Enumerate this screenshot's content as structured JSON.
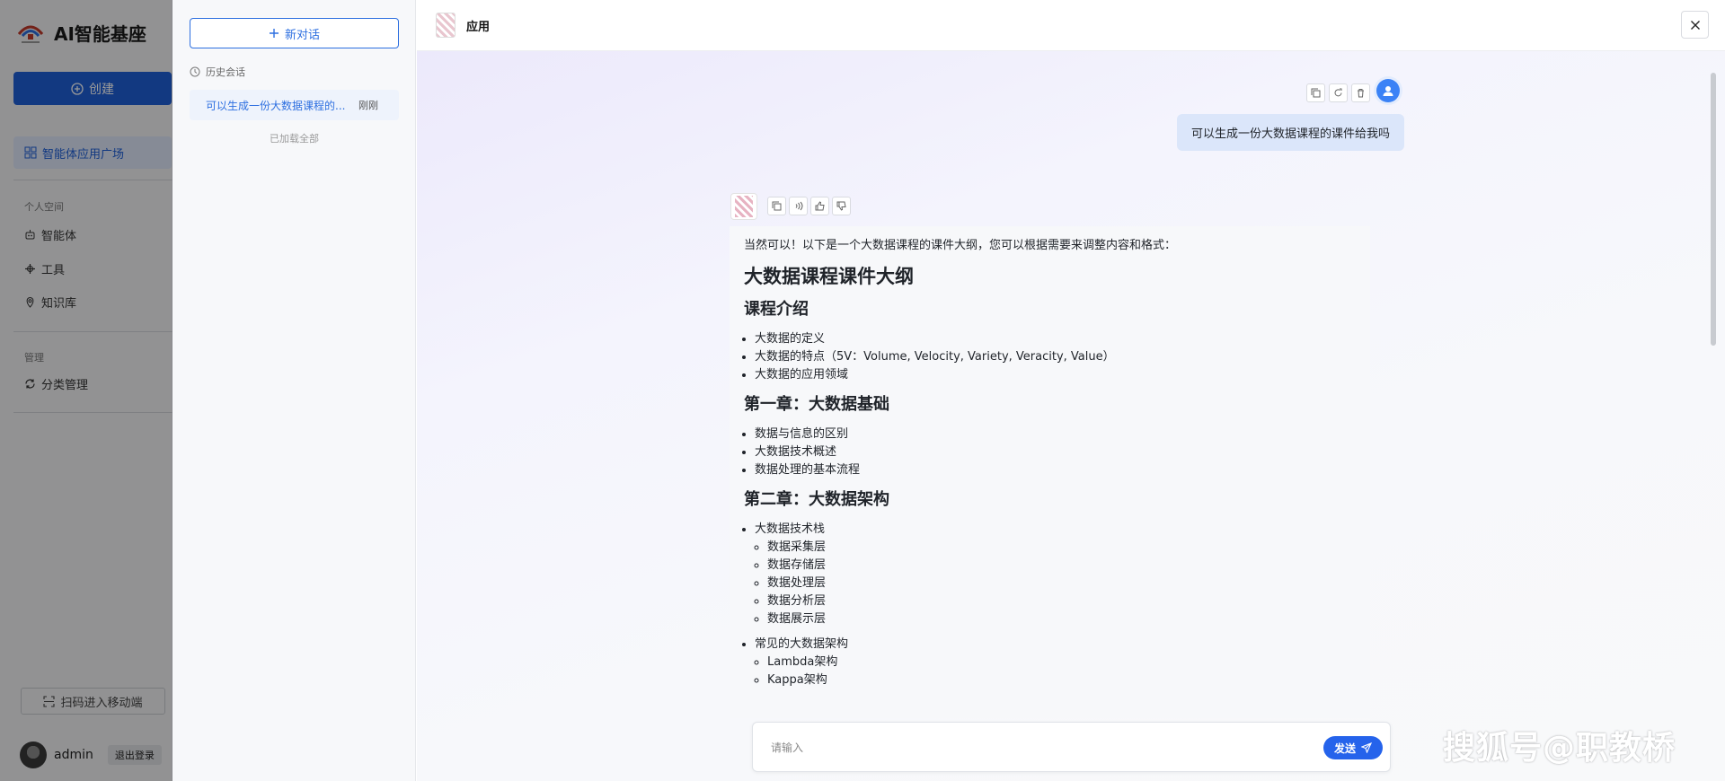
{
  "sidebar": {
    "brand_title": "AI智能基座",
    "create_label": "创建",
    "nav_active_label": "智能体应用广场",
    "personal_section": "个人空间",
    "personal_items": [
      "智能体",
      "工具",
      "知识库"
    ],
    "manage_section": "管理",
    "manage_items": [
      "分类管理"
    ],
    "scan_label": "扫码进入移动端",
    "username": "admin",
    "logout_label": "退出登录"
  },
  "history": {
    "new_chat_label": "新对话",
    "section_label": "历史会话",
    "items": [
      {
        "title": "可以生成一份大数据课程的...",
        "time": "刚刚"
      }
    ],
    "loaded_all_label": "已加载全部"
  },
  "header": {
    "app_title": "应用"
  },
  "chat": {
    "user_message": "可以生成一份大数据课程的课件给我吗",
    "answer": {
      "intro": "当然可以！以下是一个大数据课程的课件大纲，您可以根据需要来调整内容和格式：",
      "title": "大数据课程课件大纲",
      "sec1_title": "课程介绍",
      "sec1_items": [
        "大数据的定义",
        "大数据的特点（5V：Volume, Velocity, Variety, Veracity, Value）",
        "大数据的应用领域"
      ],
      "sec2_title": "第一章：大数据基础",
      "sec2_items": [
        "数据与信息的区别",
        "大数据技术概述",
        "数据处理的基本流程"
      ],
      "sec3_title": "第二章：大数据架构",
      "sec3_group1": "大数据技术栈",
      "sec3_group1_items": [
        "数据采集层",
        "数据存储层",
        "数据处理层",
        "数据分析层",
        "数据展示层"
      ],
      "sec3_group2": "常见的大数据架构",
      "sec3_group2_items": [
        "Lambda架构",
        "Kappa架构"
      ]
    },
    "input_placeholder": "请输入",
    "send_label": "发送"
  },
  "watermark": "搜狐号@职教桥",
  "colors": {
    "accent": "#1f5fd8",
    "send": "#2563eb",
    "user_bubble": "#dbe6fa"
  }
}
